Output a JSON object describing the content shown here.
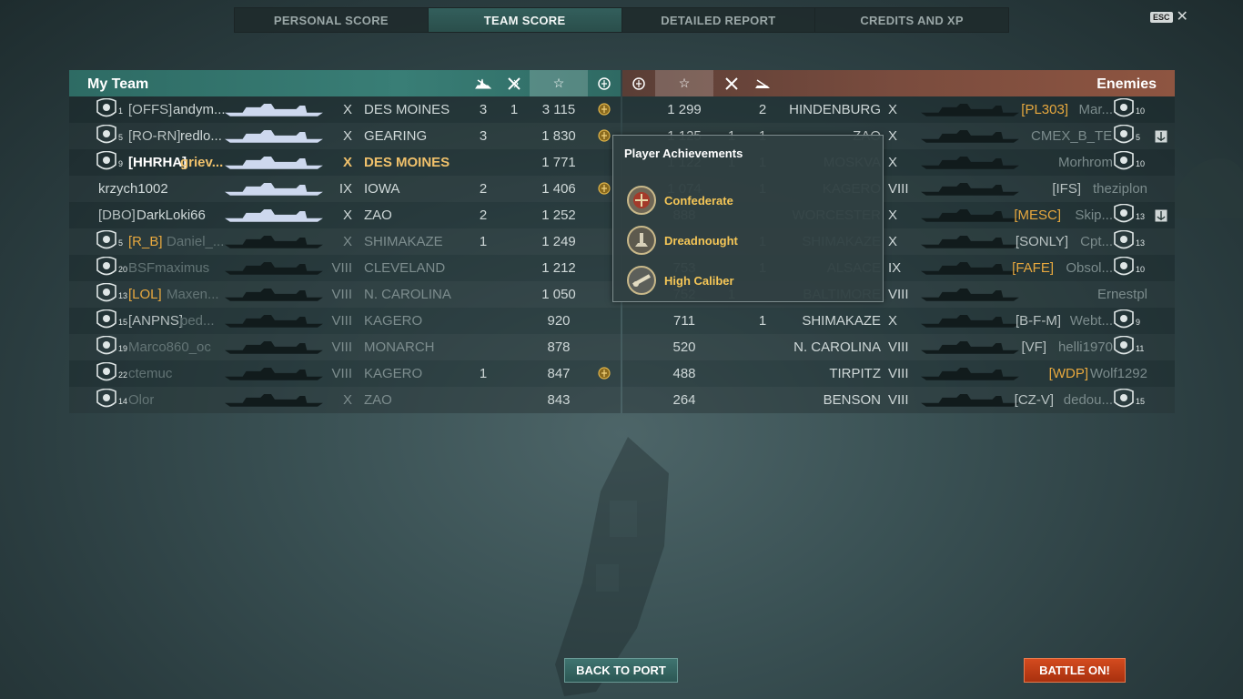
{
  "tabs": [
    {
      "label": "PERSONAL SCORE",
      "active": false
    },
    {
      "label": "TEAM SCORE",
      "active": true
    },
    {
      "label": "DETAILED REPORT",
      "active": false
    },
    {
      "label": "CREDITS AND XP",
      "active": false
    }
  ],
  "esc": {
    "key": "ESC",
    "close": "✕"
  },
  "my_team": {
    "title": "My Team",
    "rows": [
      {
        "level": "1",
        "clan": "[OFFS]",
        "clan_style": "",
        "name": "andym...",
        "name_style": "",
        "tier": "X",
        "ship": "DES MOINES",
        "ship_style": "",
        "kills": "3",
        "planes": "1",
        "xp": "3 115",
        "medal": true
      },
      {
        "level": "5",
        "clan": "[RO-RN]",
        "clan_style": "",
        "name": "redlo...",
        "name_style": "",
        "tier": "X",
        "ship": "GEARING",
        "ship_style": "",
        "kills": "3",
        "planes": "",
        "xp": "1 830",
        "medal": true
      },
      {
        "level": "9",
        "clan": "[HHRHA]",
        "clan_style": "bold",
        "name": "griev...",
        "name_style": "bold",
        "tier": "X",
        "ship": "DES MOINES",
        "ship_style": "gold",
        "kills": "",
        "planes": "",
        "xp": "1 771",
        "medal": false
      },
      {
        "level": "",
        "clan": "",
        "clan_style": "",
        "name": "krzych1002",
        "name_style": "",
        "tier": "IX",
        "ship": "IOWA",
        "ship_style": "",
        "kills": "2",
        "planes": "",
        "xp": "1 406",
        "medal": true
      },
      {
        "level": "",
        "clan": "[DBO]",
        "clan_style": "",
        "name": "DarkLoki66",
        "name_style": "",
        "tier": "X",
        "ship": "ZAO",
        "ship_style": "",
        "kills": "2",
        "planes": "",
        "xp": "1 252",
        "medal": false
      },
      {
        "level": "5",
        "clan": "[R_B]",
        "clan_style": "gold",
        "name": "Daniel_...",
        "name_style": "dim",
        "tier": "X",
        "ship": "SHIMAKAZE",
        "ship_style": "dim",
        "kills": "1",
        "planes": "",
        "xp": "1 249",
        "medal": false
      },
      {
        "level": "20",
        "clan": "",
        "clan_style": "",
        "name": "BSFmaximus",
        "name_style": "dim",
        "tier": "VIII",
        "ship": "CLEVELAND",
        "ship_style": "dim",
        "kills": "",
        "planes": "",
        "xp": "1 212",
        "medal": false
      },
      {
        "level": "13",
        "clan": "[LOL]",
        "clan_style": "gold",
        "name": "Maxen...",
        "name_style": "dim",
        "tier": "VIII",
        "ship": "N. CAROLINA",
        "ship_style": "dim",
        "kills": "",
        "planes": "",
        "xp": "1 050",
        "medal": false
      },
      {
        "level": "15",
        "clan": "[ANPNS]",
        "clan_style": "",
        "name": "ped...",
        "name_style": "dim",
        "tier": "VIII",
        "ship": "KAGERO",
        "ship_style": "dim",
        "kills": "",
        "planes": "",
        "xp": "920",
        "medal": false
      },
      {
        "level": "19",
        "clan": "",
        "clan_style": "",
        "name": "Marco860_oc",
        "name_style": "dim",
        "tier": "VIII",
        "ship": "MONARCH",
        "ship_style": "dim",
        "kills": "",
        "planes": "",
        "xp": "878",
        "medal": false
      },
      {
        "level": "22",
        "clan": "",
        "clan_style": "",
        "name": "ctemuc",
        "name_style": "dim",
        "tier": "VIII",
        "ship": "KAGERO",
        "ship_style": "dim",
        "kills": "1",
        "planes": "",
        "xp": "847",
        "medal": true
      },
      {
        "level": "14",
        "clan": "",
        "clan_style": "",
        "name": "Olor",
        "name_style": "dim",
        "tier": "X",
        "ship": "ZAO",
        "ship_style": "dim",
        "kills": "",
        "planes": "",
        "xp": "843",
        "medal": false
      }
    ]
  },
  "enemies": {
    "title": "Enemies",
    "rows": [
      {
        "xp": "1 299",
        "planes": "",
        "kills": "2",
        "ship": "HINDENBURG",
        "tier": "X",
        "clan": "[PL303]",
        "clan_style": "gold",
        "name": "Mar...",
        "level": "10",
        "anchor": false
      },
      {
        "xp": "1 125",
        "planes": "1",
        "kills": "1",
        "ship": "ZAO",
        "tier": "X",
        "clan": "",
        "clan_style": "",
        "name": "CMEX_B_TE...",
        "level": "5",
        "anchor": true
      },
      {
        "xp": "1 122",
        "planes": "1",
        "kills": "1",
        "ship": "MOSKVA",
        "tier": "X",
        "clan": "",
        "clan_style": "",
        "name": "Morhrom",
        "level": "10",
        "anchor": false
      },
      {
        "xp": "1 074",
        "planes": "",
        "kills": "1",
        "ship": "KAGERO",
        "tier": "VIII",
        "clan": "[IFS]",
        "clan_style": "",
        "name": "theziplon",
        "level": "",
        "anchor": false
      },
      {
        "xp": "888",
        "planes": "",
        "kills": "",
        "ship": "WORCESTER",
        "tier": "X",
        "clan": "[MESC]",
        "clan_style": "gold",
        "name": "Skip...",
        "level": "13",
        "anchor": true
      },
      {
        "xp": "",
        "planes": "",
        "kills": "1",
        "ship": "SHIMAKAZE",
        "tier": "X",
        "clan": "[SONLY]",
        "clan_style": "",
        "name": "Cpt...",
        "level": "13",
        "anchor": false
      },
      {
        "xp": "753",
        "planes": "",
        "kills": "1",
        "ship": "ALSACE",
        "tier": "IX",
        "clan": "[FAFE]",
        "clan_style": "gold",
        "name": "Obsol...",
        "level": "10",
        "anchor": false
      },
      {
        "xp": "752",
        "planes": "1",
        "kills": "",
        "ship": "BALTIMORE",
        "tier": "VIII",
        "clan": "",
        "clan_style": "",
        "name": "Ernestpl",
        "level": "",
        "anchor": false
      },
      {
        "xp": "711",
        "planes": "",
        "kills": "1",
        "ship": "SHIMAKAZE",
        "tier": "X",
        "clan": "[B-F-M]",
        "clan_style": "",
        "name": "Webt...",
        "level": "9",
        "anchor": false
      },
      {
        "xp": "520",
        "planes": "",
        "kills": "",
        "ship": "N. CAROLINA",
        "tier": "VIII",
        "clan": "[VF]",
        "clan_style": "",
        "name": "helli1970",
        "level": "11",
        "anchor": false
      },
      {
        "xp": "488",
        "planes": "",
        "kills": "",
        "ship": "TIRPITZ",
        "tier": "VIII",
        "clan": "[WDP]",
        "clan_style": "gold",
        "name": "Wolf1292",
        "level": "",
        "anchor": false
      },
      {
        "xp": "264",
        "planes": "",
        "kills": "",
        "ship": "BENSON",
        "tier": "VIII",
        "clan": "[CZ-V]",
        "clan_style": "",
        "name": "dedou...",
        "level": "15",
        "anchor": false
      }
    ]
  },
  "popup": {
    "title": "Player Achievements",
    "achievements": [
      {
        "label": "Confederate",
        "icon": "confederate-medal-icon"
      },
      {
        "label": "Dreadnought",
        "icon": "dreadnought-medal-icon"
      },
      {
        "label": "High Caliber",
        "icon": "high-caliber-medal-icon"
      }
    ]
  },
  "buttons": {
    "back": "BACK TO PORT",
    "battle": "BATTLE ON!"
  },
  "colors": {
    "my_team": "#397e76",
    "enemies": "#8e5541",
    "gold": "#f0c16b",
    "battle": "#c8401a"
  }
}
